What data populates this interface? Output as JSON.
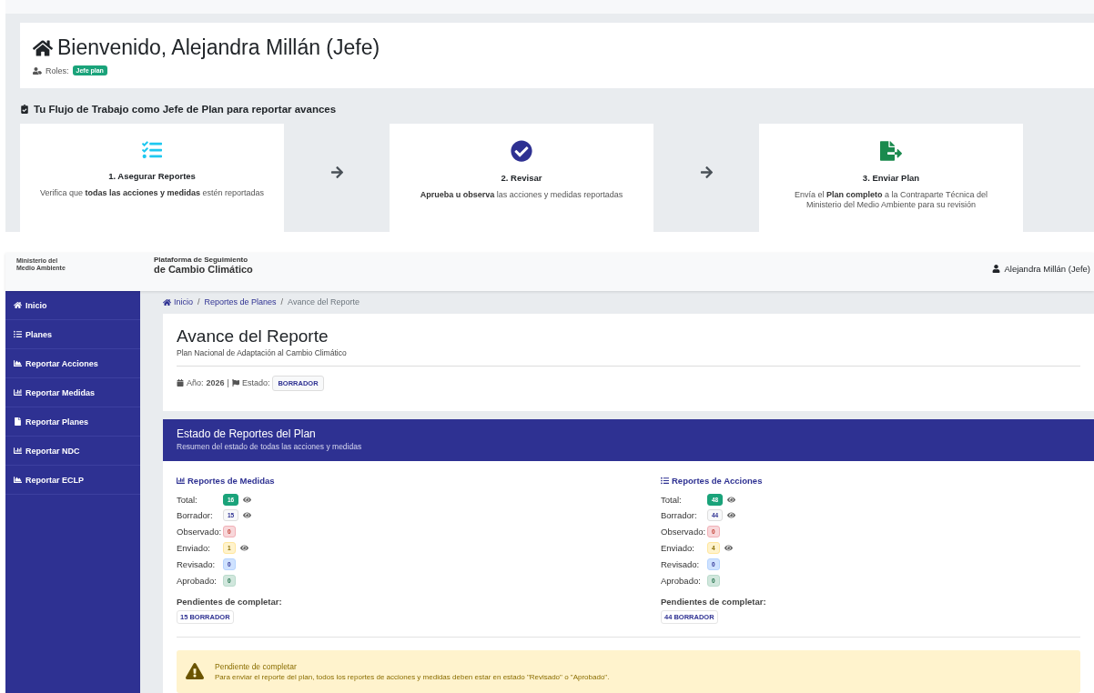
{
  "welcome": {
    "title": "Bienvenido, Alejandra Millán (Jefe)",
    "roles_label": "Roles:",
    "roles": [
      "Jefe plan"
    ]
  },
  "workflow": {
    "heading": "Tu Flujo de Trabajo como Jefe de Plan para reportar avances",
    "steps": [
      {
        "kind": "checklist",
        "title": "1. Asegurar Reportes",
        "description": "Verifica que **todas las acciones y medidas** estén reportadas"
      },
      {
        "kind": "check-circle",
        "title": "2. Revisar",
        "description": "**Aprueba u observa** las acciones y medidas reportadas"
      },
      {
        "kind": "file-export",
        "title": "3. Enviar Plan",
        "description": "Envía el **Plan completo** a la Contraparte Técnica del Ministerio del Medio Ambiente para su revisión"
      }
    ]
  },
  "header": {
    "ministry": "Ministerio del Medio Ambiente",
    "platform_line1": "Plataforma de Seguimiento",
    "platform_line2": "de Cambio Climático",
    "user": "Alejandra Millán (Jefe)"
  },
  "sidebar": {
    "items": [
      {
        "kind": "home",
        "label": "Inicio"
      },
      {
        "kind": "list",
        "label": "Planes"
      },
      {
        "kind": "area",
        "label": "Reportar Acciones"
      },
      {
        "kind": "bar",
        "label": "Reportar Medidas"
      },
      {
        "kind": "file",
        "label": "Reportar Planes"
      },
      {
        "kind": "bar",
        "label": "Reportar NDC"
      },
      {
        "kind": "area",
        "label": "Reportar ECLP"
      }
    ]
  },
  "breadcrumb": {
    "separator": "/",
    "items": [
      "Inicio",
      "Reportes de Planes",
      "Avance del Reporte"
    ]
  },
  "report": {
    "title": "Avance del Reporte",
    "subtitle": "Plan Nacional de Adaptación al Cambio Climático",
    "year_label": "Año:",
    "year": "2026",
    "separator": "|",
    "status_label": "Estado:",
    "status": "BORRADOR"
  },
  "summary": {
    "title": "Estado de Reportes del Plan",
    "subtitle": "Resumen del estado de todas las acciones y medidas",
    "groups": [
      {
        "kind": "bar",
        "title": "Reportes de Medidas",
        "rows": [
          {
            "kind": "total",
            "label": "Total:",
            "count": "16",
            "viewable": true
          },
          {
            "kind": "borrador",
            "label": "Borrador:",
            "count": "15",
            "viewable": true
          },
          {
            "kind": "observado",
            "label": "Observado:",
            "count": "0",
            "viewable": false
          },
          {
            "kind": "enviado",
            "label": "Enviado:",
            "count": "1",
            "viewable": true
          },
          {
            "kind": "revisado",
            "label": "Revisado:",
            "count": "0",
            "viewable": false
          },
          {
            "kind": "aprobado",
            "label": "Aprobado:",
            "count": "0",
            "viewable": false
          }
        ],
        "pending_label": "Pendientes de completar:",
        "pending": [
          "15 BORRADOR"
        ]
      },
      {
        "kind": "list",
        "title": "Reportes de Acciones",
        "rows": [
          {
            "kind": "total",
            "label": "Total:",
            "count": "48",
            "viewable": true
          },
          {
            "kind": "borrador",
            "label": "Borrador:",
            "count": "44",
            "viewable": true
          },
          {
            "kind": "observado",
            "label": "Observado:",
            "count": "0",
            "viewable": false
          },
          {
            "kind": "enviado",
            "label": "Enviado:",
            "count": "4",
            "viewable": true
          },
          {
            "kind": "revisado",
            "label": "Revisado:",
            "count": "0",
            "viewable": false
          },
          {
            "kind": "aprobado",
            "label": "Aprobado:",
            "count": "0",
            "viewable": false
          }
        ],
        "pending_label": "Pendientes de completar:",
        "pending": [
          "44 BORRADOR"
        ]
      }
    ]
  },
  "alert": {
    "title": "Pendiente de completar",
    "message": "Para enviar el reporte del plan, todos los reportes de acciones y medidas deben estar en estado \"Revisado\" o \"Aprobado\"."
  }
}
